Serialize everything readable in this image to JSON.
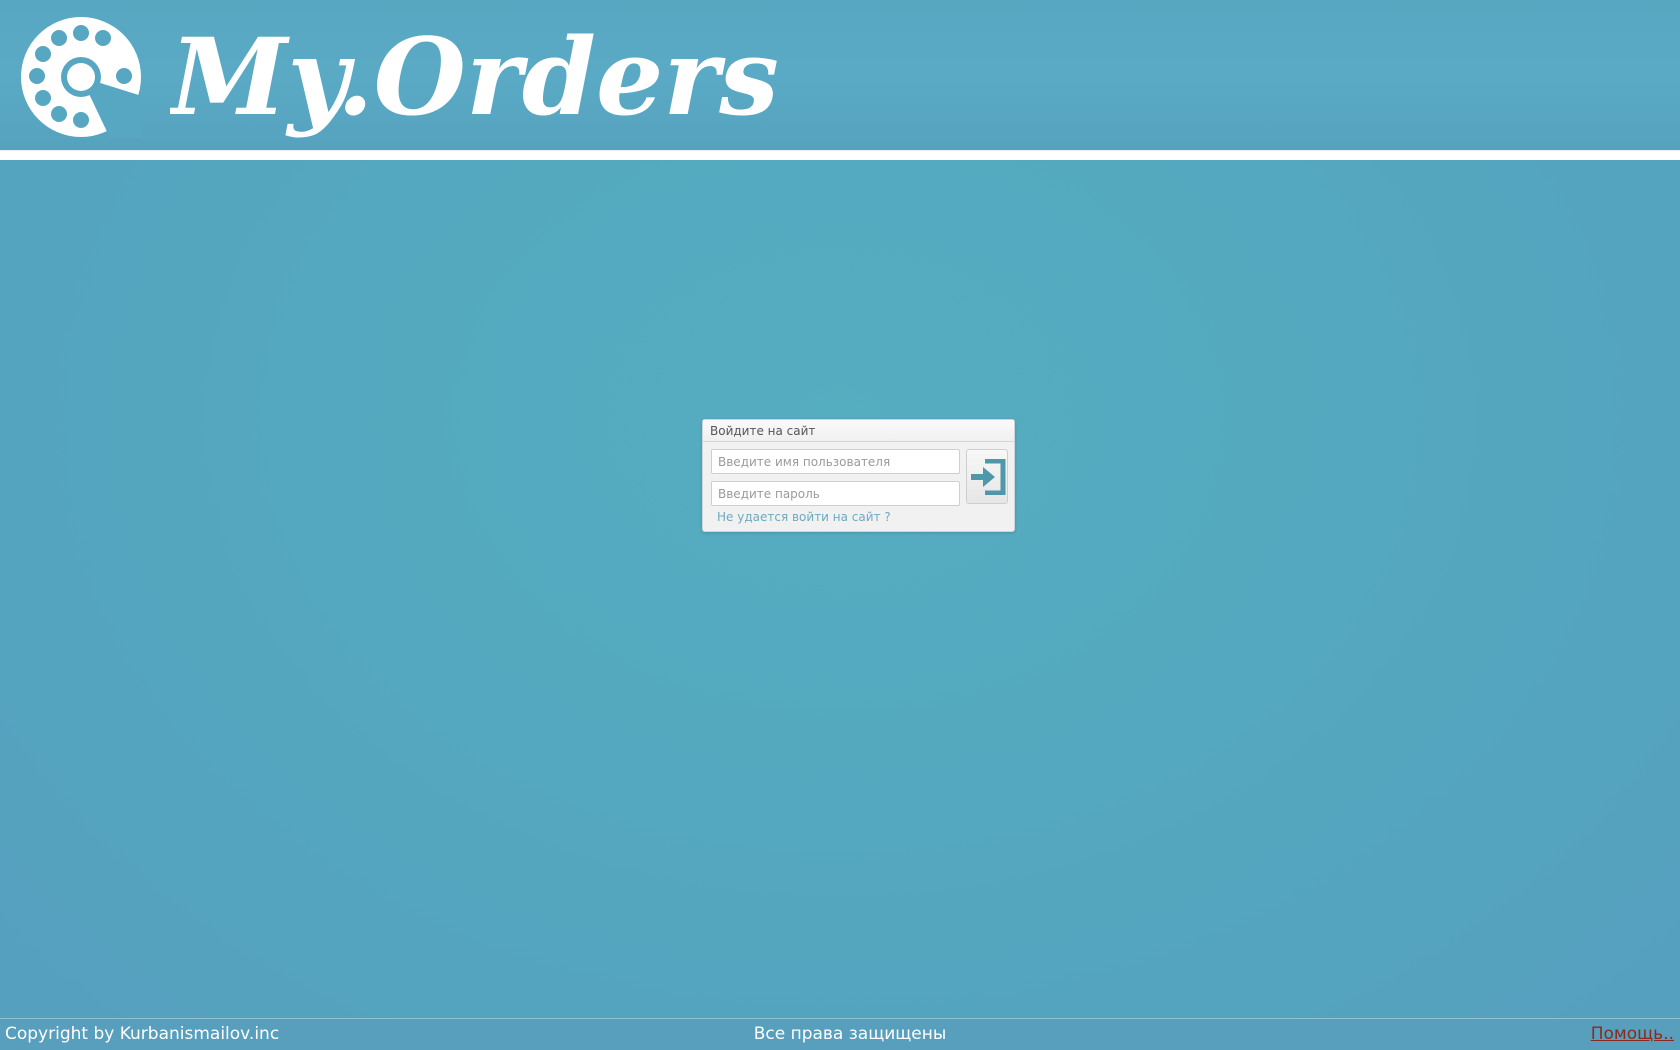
{
  "header": {
    "logo_text": "My.Orders"
  },
  "login": {
    "title": "Войдите на сайт",
    "username_placeholder": "Введите имя пользователя",
    "password_placeholder": "Введите пароль",
    "forgot_link": "Не удается войти на сайт ?",
    "submit_icon": "sign-in-icon"
  },
  "footer": {
    "copyright": "Copyright by Kurbanismailov.inc",
    "rights": "Все права защищены",
    "help_link": "Помощь.."
  },
  "colors": {
    "background": "#55a7bf",
    "header_stripe": "#ffffff",
    "link": "#6fa9c0",
    "help_link": "#8b2a1e",
    "icon": "#4f97ab"
  }
}
